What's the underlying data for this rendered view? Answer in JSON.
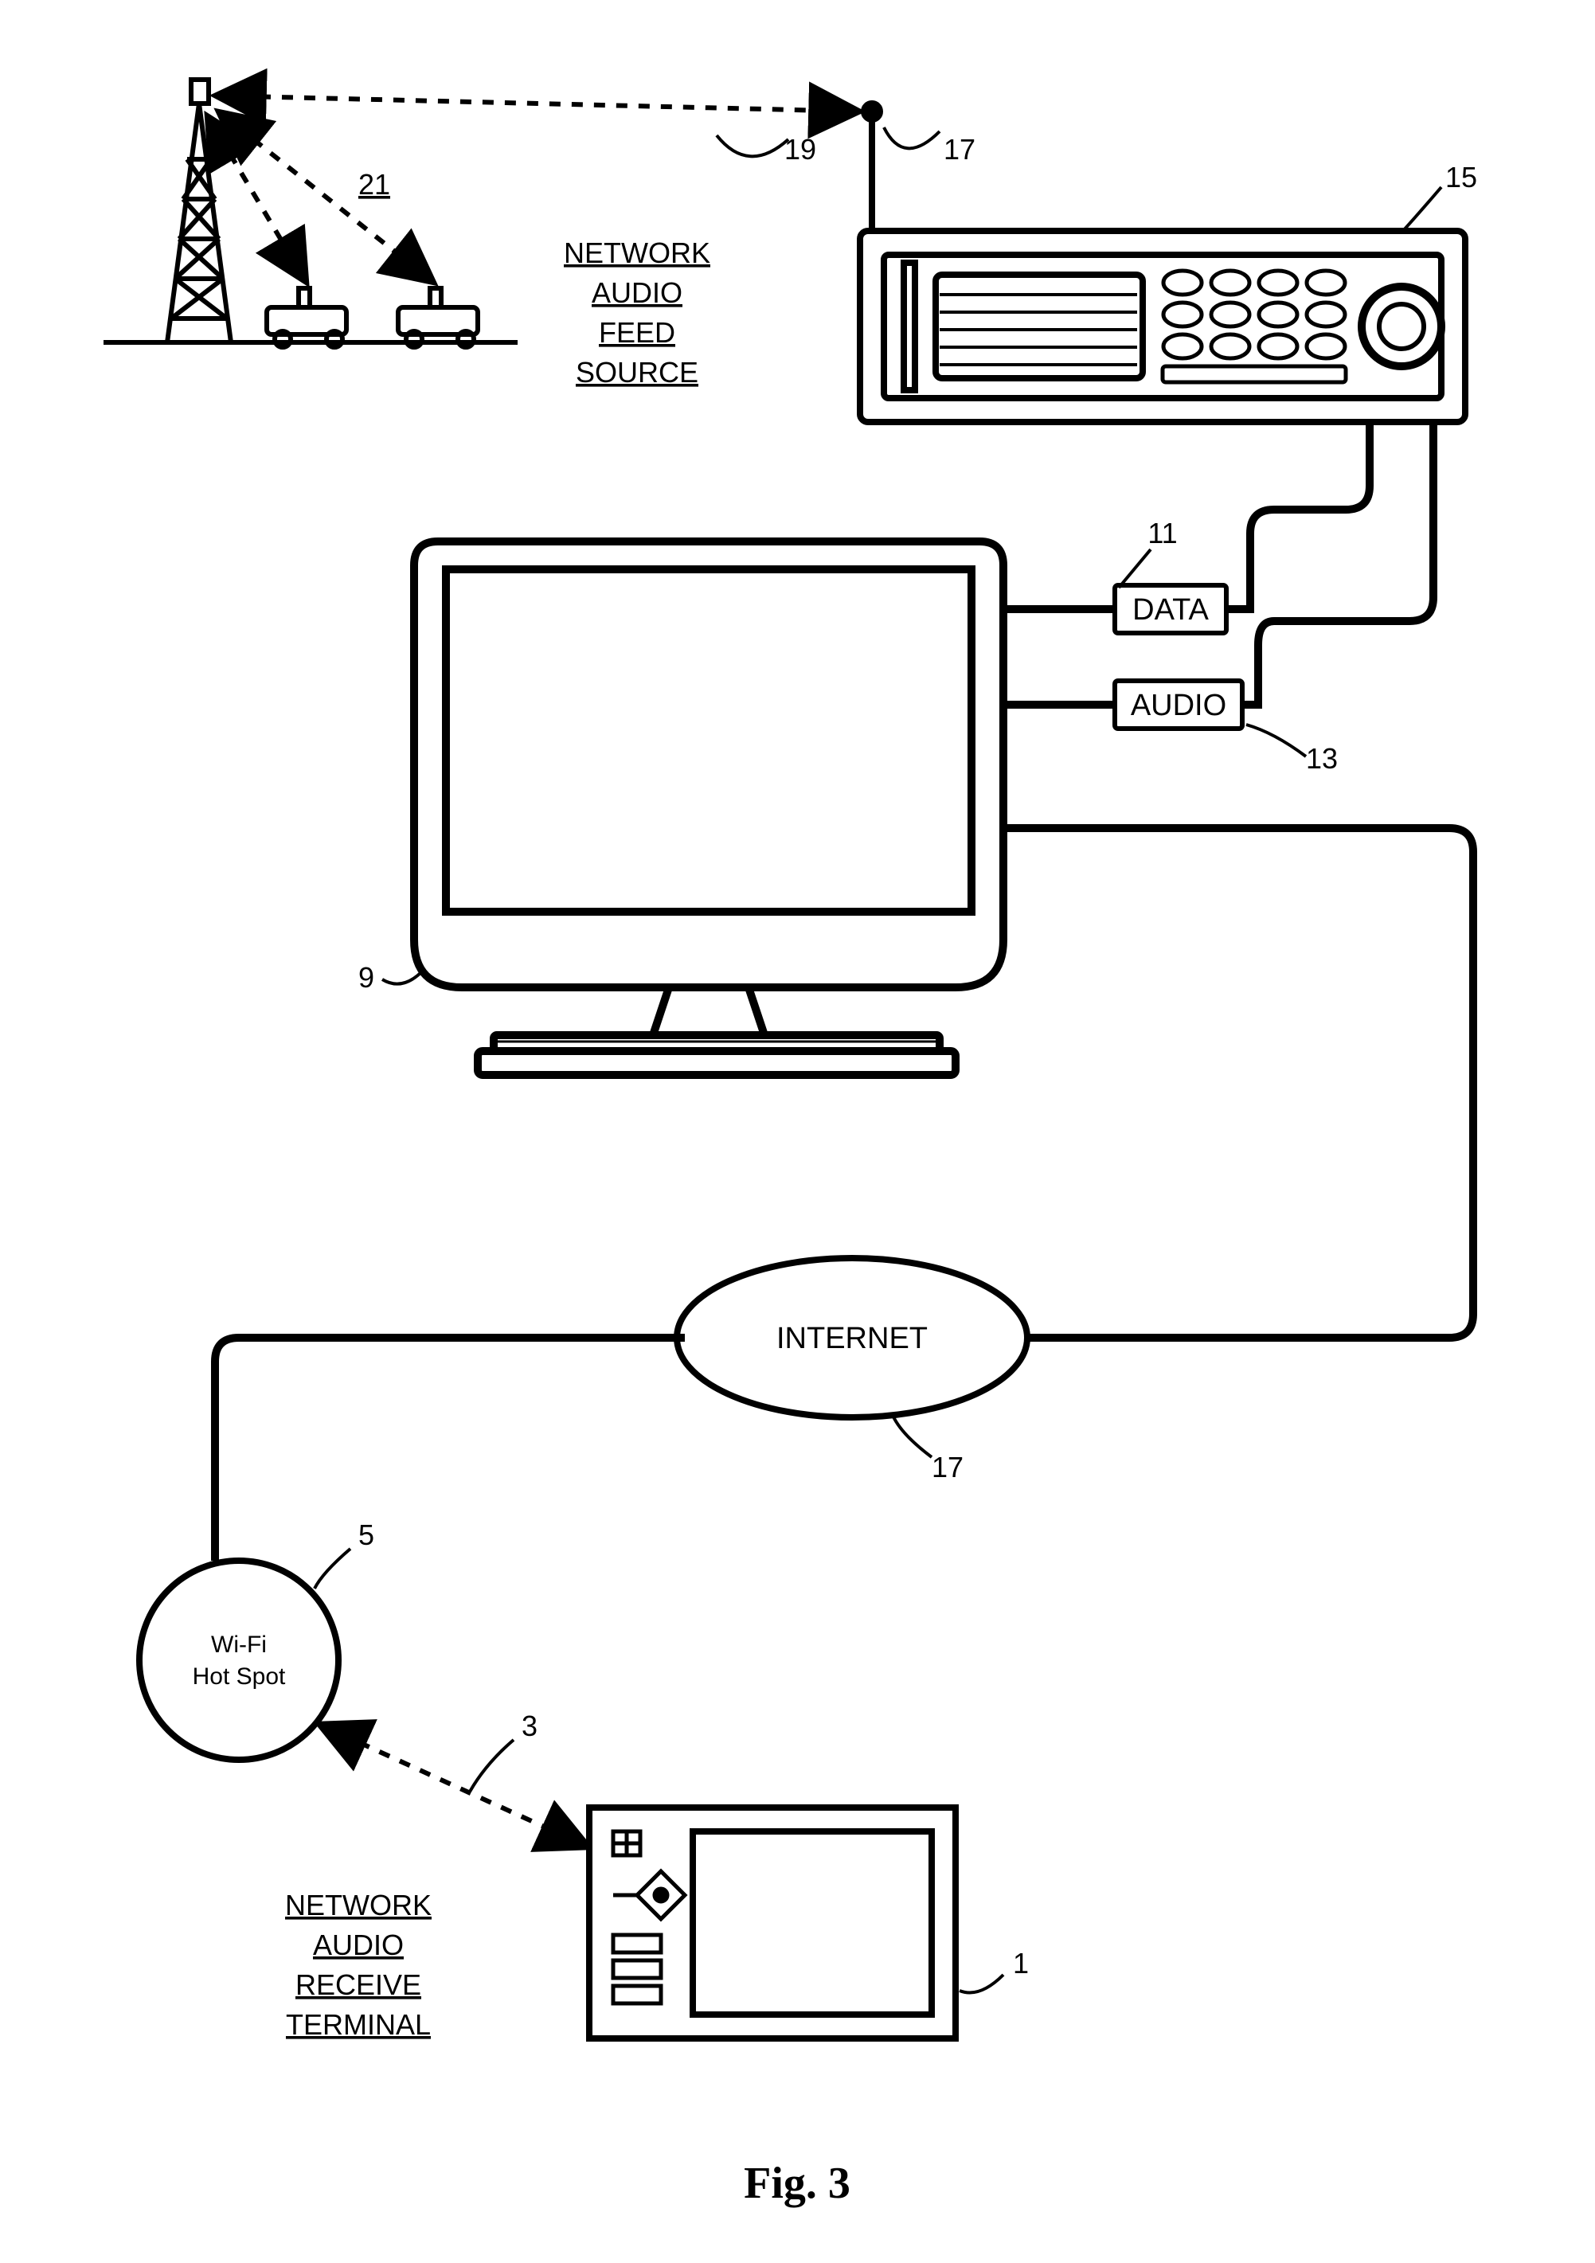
{
  "labels": {
    "source_title_line1": "NETWORK",
    "source_title_line2": "AUDIO",
    "source_title_line3": "FEED",
    "source_title_line4": "SOURCE",
    "receive_title_line1": "NETWORK",
    "receive_title_line2": "AUDIO",
    "receive_title_line3": "RECEIVE",
    "receive_title_line4": "TERMINAL",
    "data_box": "DATA",
    "audio_box": "AUDIO",
    "internet": "INTERNET",
    "wifi_line1": "Wi-Fi",
    "wifi_line2": "Hot Spot"
  },
  "refs": {
    "r1": "1",
    "r3": "3",
    "r5": "5",
    "r9": "9",
    "r11": "11",
    "r13": "13",
    "r15": "15",
    "r17a": "17",
    "r17b": "17",
    "r19": "19",
    "r21": "21"
  },
  "caption": "Fig. 3"
}
